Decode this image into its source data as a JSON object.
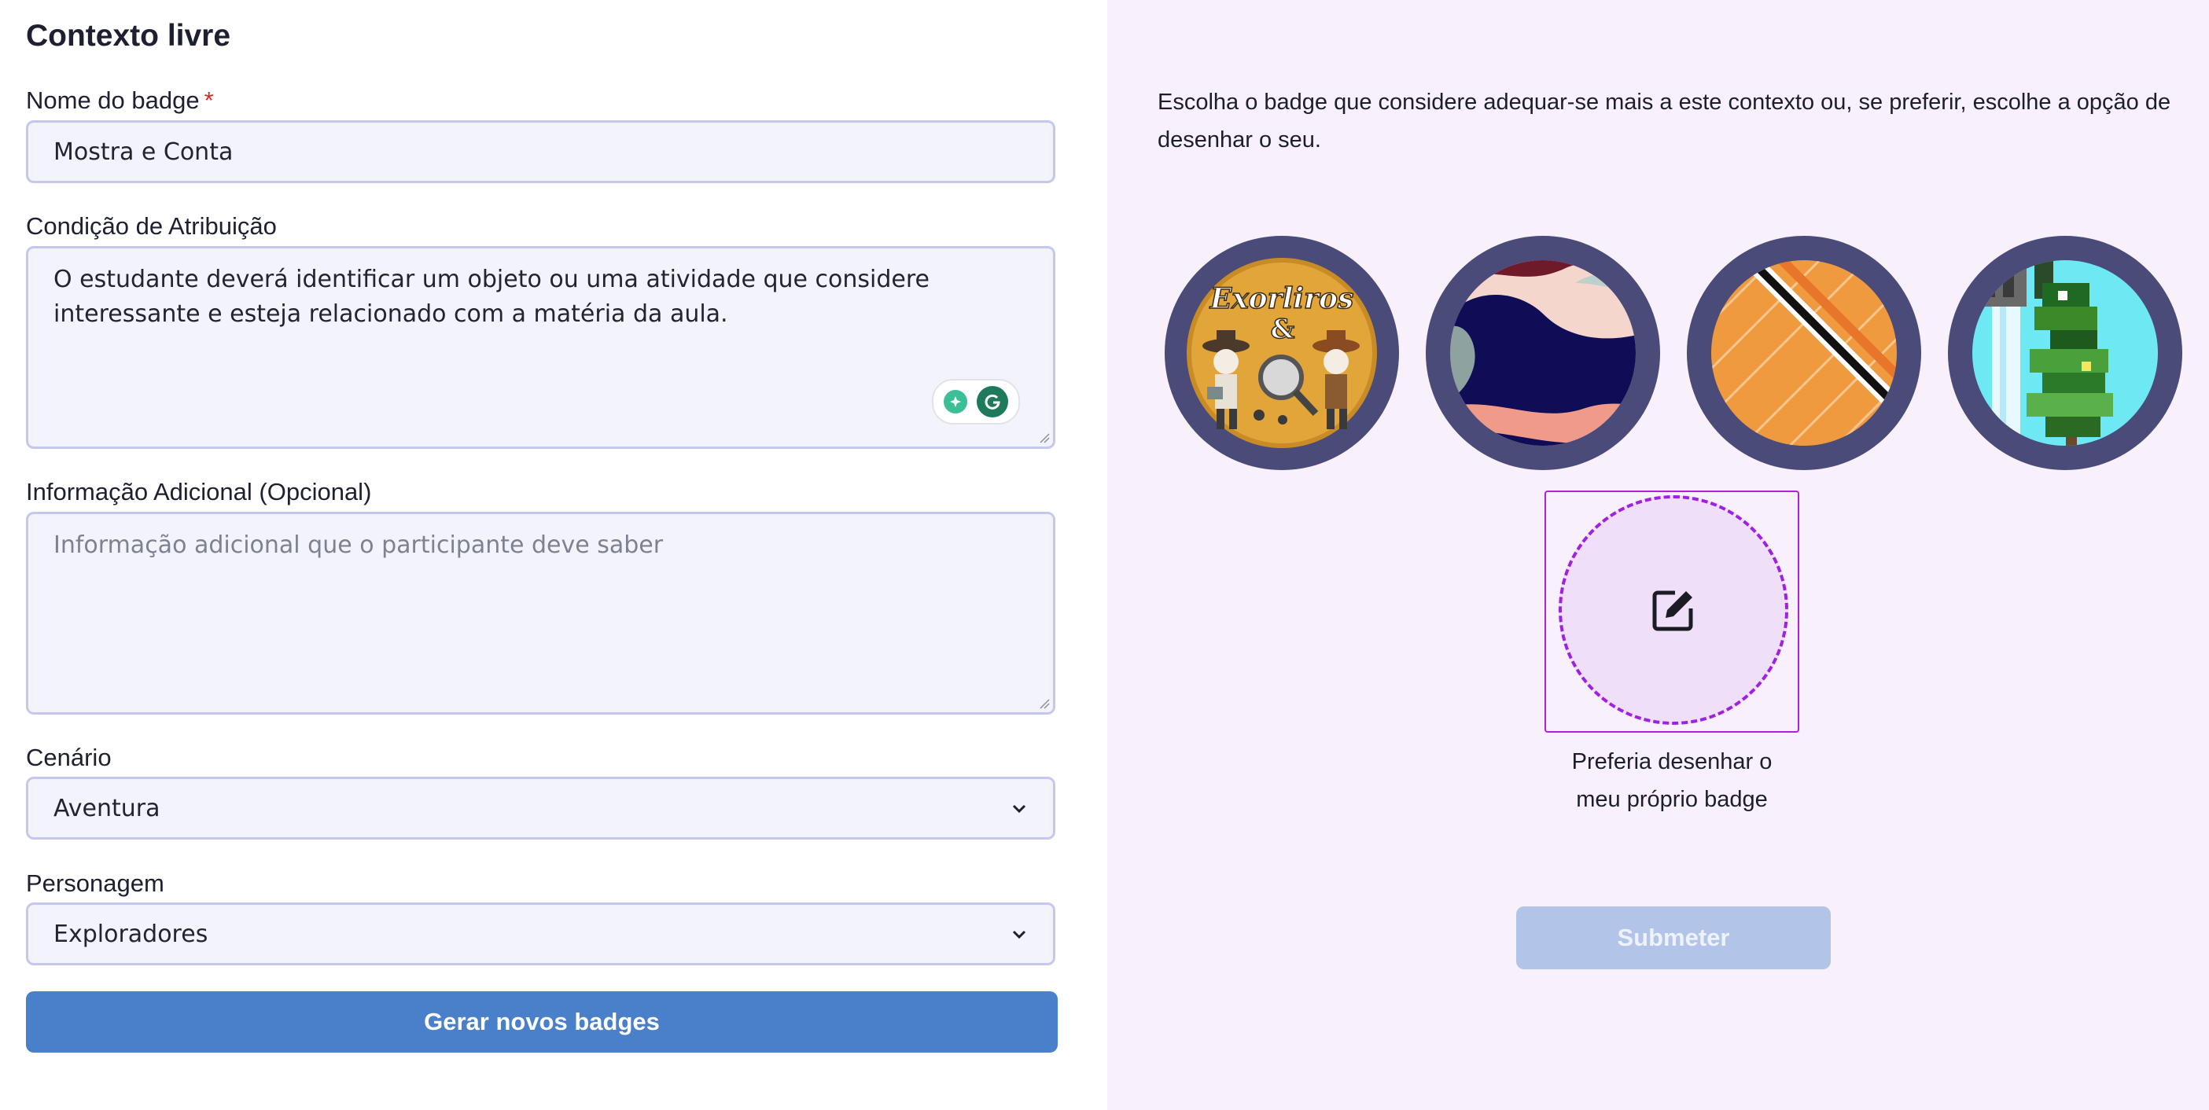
{
  "form": {
    "title": "Contexto livre",
    "badge_name": {
      "label": "Nome do badge",
      "required_mark": "*",
      "value": "Mostra e Conta"
    },
    "condition": {
      "label": "Condição de Atribuição",
      "value": "O estudante deverá identificar um objeto ou uma atividade que considere interessante e esteja relacionado com a matéria da aula."
    },
    "extra_info": {
      "label": "Informação Adicional (Opcional)",
      "placeholder": "Informação adicional que o participante deve saber"
    },
    "scenario": {
      "label": "Cenário",
      "selected": "Aventura"
    },
    "character": {
      "label": "Personagem",
      "selected": "Exploradores"
    },
    "generate_button": "Gerar novos badges"
  },
  "panel": {
    "intro": "Escolha o badge que considere adequar-se mais a este contexto ou, se preferir, escolhe a opção de desenhar o seu.",
    "badges": [
      {
        "icon": "explorers-badge-image",
        "text": "Exorliros",
        "ampersand": "&"
      },
      {
        "icon": "abstract-waves-badge-image"
      },
      {
        "icon": "orange-stripes-badge-image"
      },
      {
        "icon": "pixel-tree-badge-image"
      }
    ],
    "draw_option": {
      "icon": "edit-icon",
      "caption_line1": "Preferia desenhar o",
      "caption_line2": "meu próprio badge"
    },
    "submit_button": "Submeter"
  },
  "colors": {
    "primary": "#4a80c9",
    "submit_disabled": "#b2c5e8",
    "panel_bg": "#f8f1fc",
    "badge_ring": "#4a4b78",
    "draw_accent": "#a020e2"
  }
}
